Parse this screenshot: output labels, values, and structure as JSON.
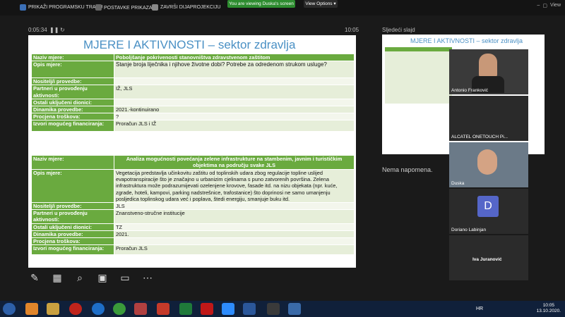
{
  "topbar": {
    "item1": "PRIKAŽI PROGRAMSKU TRAKU",
    "item2": "POSTAVKE PRIKAZA ▾",
    "item3": "ZAVRŠI DIJAPROJEKCIJU",
    "banner": "You are viewing Duska's screen",
    "view_options": "View Options ▾",
    "view": "View"
  },
  "presenter": {
    "elapsed": "0:05:34",
    "clock": "10:05",
    "next_label": "Sljedeći slajd",
    "notes": "Nema napomena."
  },
  "slide": {
    "title": "MJERE I AKTIVNOSTI – sektor zdravlja",
    "table1": [
      {
        "label": "Naziv mjere:",
        "value": "Poboljšanje pokrivenosti stanovništva zdravstvenom zaštitom",
        "header": true
      },
      {
        "label": "Opis mjere:",
        "value": "Stanje broja liječnika i njihove životne dobi? Potrebe za odredenom strukom usluge?",
        "red": true
      },
      {
        "label": "Nositelj/i provedbe:",
        "value": ""
      },
      {
        "label": "Partneri u provođenju aktivnosti:",
        "value": "IŽ, JLS"
      },
      {
        "label": "Ostali uključeni dionici:",
        "value": ""
      },
      {
        "label": "Dinamika provedbe:",
        "value": "2021.-kontinuirano"
      },
      {
        "label": "Procjena troškova:",
        "value": "?"
      },
      {
        "label": "Izvori mogućeg financiranja:",
        "value": "Proračun JLS i IŽ"
      }
    ],
    "table2": [
      {
        "label": "Naziv mjere:",
        "value": "Analiza mogućnosti povećanja zelene infrastrukture na stambenim, javnim i turističkim objektima na području svake JLS",
        "header": true
      },
      {
        "label": "Opis mjere:",
        "value": "Vegetacija predstavlja učinkovitu zaštitu od toplinskih udara zbog regulacije topline uslijed evapotranspiracije što je značajno u urbanizim cjelinama s puno zatvorenih površina. Zelena infrastruktura može podrazumijevati ozelenjene krovove, fasade itd. na nizu objekata (npr. kuće, zgrade, hoteli, kampovi, parking nadstrešnice, trafostanice) što doprinosi ne samo umanjenju posljedica toplinskog udara već i poplava, štedi energiju, smanjuje buku itd."
      },
      {
        "label": "Nositelj/i provedbe:",
        "value": "JLS"
      },
      {
        "label": "Partneri u provođenju aktivnosti:",
        "value": "Znanstveno-stručne institucije"
      },
      {
        "label": "Ostali uključeni dionici:",
        "value": "TZ"
      },
      {
        "label": "Dinamika provedbe:",
        "value": "2021."
      },
      {
        "label": "Procjena troškova:",
        "value": ""
      },
      {
        "label": "Izvori mogućeg financiranja:",
        "value": "Proračun JLS"
      }
    ]
  },
  "next_slide": {
    "title": "MJERE I AKTIVNOSTI – sektor zdravlja"
  },
  "participants": [
    {
      "name": "Antonio Franković"
    },
    {
      "name": "ALCATEL ONETOUCH Pi..."
    },
    {
      "name": "Duska"
    },
    {
      "name": "Doriano Labinjan",
      "initial": "D"
    },
    {
      "name": "Iva Juranović"
    }
  ],
  "taskbar": {
    "lang": "HR",
    "time": "10:05",
    "date": "13.10.2020."
  },
  "colors": {
    "accent_green": "#6aaa3f",
    "title_blue": "#4a90c4",
    "banner_green": "#2d8c2f"
  }
}
